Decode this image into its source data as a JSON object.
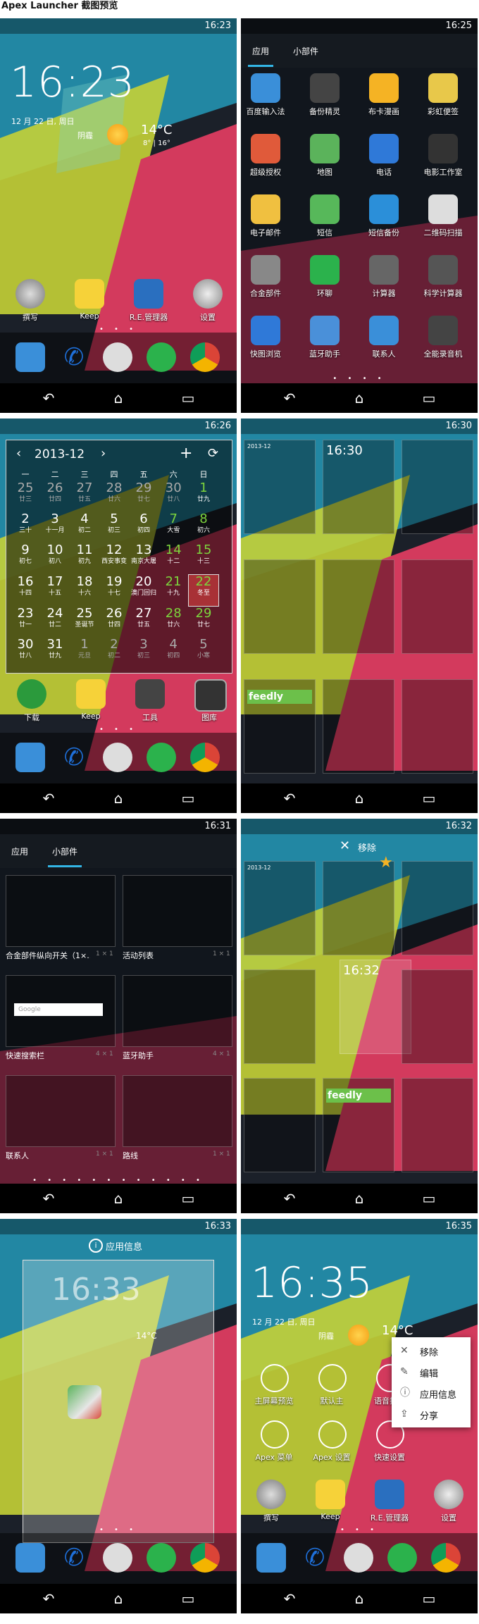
{
  "page_title": "Apex Launcher 截图预览",
  "status_times": [
    "16:23",
    "16:25",
    "16:26",
    "16:30",
    "16:31",
    "16:32",
    "16:33",
    "16:35"
  ],
  "nav": {
    "back": "↶",
    "home": "⌂",
    "recent": "▭"
  },
  "screen1": {
    "clock": "16:23",
    "date": "12 月 22 日, 周日",
    "weather_city": "阴霾",
    "temp": "14°C",
    "temp_range": "8° | 16°",
    "apps": [
      "撰写",
      "Keep",
      "R.E.管理器",
      "设置"
    ]
  },
  "screen2": {
    "tabs": [
      "应用",
      "小部件"
    ],
    "apps": [
      "百度输入法",
      "备份精灵",
      "布卡漫画",
      "彩虹便签",
      "超级授权",
      "地图",
      "电话",
      "电影工作室",
      "电子邮件",
      "短信",
      "短信备份",
      "二维码扫描",
      "合金部件",
      "环聊",
      "计算器",
      "科学计算器",
      "快图浏览",
      "蓝牙助手",
      "联系人",
      "全能录音机"
    ]
  },
  "screen3": {
    "month": "2013-12",
    "weekdays": [
      "一",
      "二",
      "三",
      "四",
      "五",
      "六",
      "日"
    ],
    "rows": [
      [
        [
          "25",
          "廿三"
        ],
        [
          "26",
          "廿四"
        ],
        [
          "27",
          "廿五"
        ],
        [
          "28",
          "廿六"
        ],
        [
          "29",
          "廿七"
        ],
        [
          "30",
          "廿八"
        ],
        [
          "1",
          "廿九"
        ]
      ],
      [
        [
          "2",
          "三十"
        ],
        [
          "3",
          "十一月"
        ],
        [
          "4",
          "初二"
        ],
        [
          "5",
          "初三"
        ],
        [
          "6",
          "初四"
        ],
        [
          "7",
          "大雪"
        ],
        [
          "8",
          "初六"
        ]
      ],
      [
        [
          "9",
          "初七"
        ],
        [
          "10",
          "初八"
        ],
        [
          "11",
          "初九"
        ],
        [
          "12",
          "西安事变"
        ],
        [
          "13",
          "南京大屠"
        ],
        [
          "14",
          "十二"
        ],
        [
          "15",
          "十三"
        ]
      ],
      [
        [
          "16",
          "十四"
        ],
        [
          "17",
          "十五"
        ],
        [
          "18",
          "十六"
        ],
        [
          "19",
          "十七"
        ],
        [
          "20",
          "澳门回归"
        ],
        [
          "21",
          "十九"
        ],
        [
          "22",
          "冬至"
        ]
      ],
      [
        [
          "23",
          "廿一"
        ],
        [
          "24",
          "廿二"
        ],
        [
          "25",
          "圣诞节"
        ],
        [
          "26",
          "廿四"
        ],
        [
          "27",
          "廿五"
        ],
        [
          "28",
          "廿六"
        ],
        [
          "29",
          "廿七"
        ]
      ],
      [
        [
          "30",
          "廿八"
        ],
        [
          "31",
          "廿九"
        ],
        [
          "1",
          "元旦"
        ],
        [
          "2",
          "初二"
        ],
        [
          "3",
          "初三"
        ],
        [
          "4",
          "初四"
        ],
        [
          "5",
          "小寒"
        ]
      ]
    ],
    "apps": [
      "下载",
      "Keep",
      "工具",
      "图库"
    ]
  },
  "screen4": {
    "mini_clock": "16:30",
    "feedly": "feedly",
    "mini_month": "2013-12"
  },
  "screen5": {
    "tabs": [
      "应用",
      "小部件"
    ],
    "widgets": [
      {
        "label": "合金部件纵向开关（1×...",
        "size": "1 × 1"
      },
      {
        "label": "活动列表",
        "size": "1 × 1"
      },
      {
        "label": "快速搜索栏",
        "size": "4 × 1"
      },
      {
        "label": "蓝牙助手",
        "size": "4 × 1"
      },
      {
        "label": "联系人",
        "size": "1 × 1"
      },
      {
        "label": "路线",
        "size": "1 × 1"
      }
    ],
    "search_hint": "Google"
  },
  "screen6": {
    "move_label": "移除",
    "mini_clock": "16:32",
    "feedly": "feedly",
    "mini_month": "2013-12"
  },
  "screen7": {
    "app_info": "应用信息",
    "clock": "16:33",
    "temp": "14°C"
  },
  "screen8": {
    "clock": "16:35",
    "date": "12 月 22 日, 周日",
    "weather_city": "阴霾",
    "temp": "14°C",
    "shortcuts": [
      "主屏幕预览",
      "默认主",
      "语音搜索",
      "Apex 菜单",
      "Apex 设置",
      "快速设置"
    ],
    "menu": [
      "移除",
      "编辑",
      "应用信息",
      "分享"
    ],
    "apps": [
      "撰写",
      "Keep",
      "R.E.管理器",
      "设置"
    ]
  },
  "colors": {
    "teal": "#1e7c96",
    "yellow": "#c6d133",
    "pink": "#d23a5c",
    "red": "#c9284a",
    "dark": "#1a2230",
    "accent": "#33b5e5"
  }
}
